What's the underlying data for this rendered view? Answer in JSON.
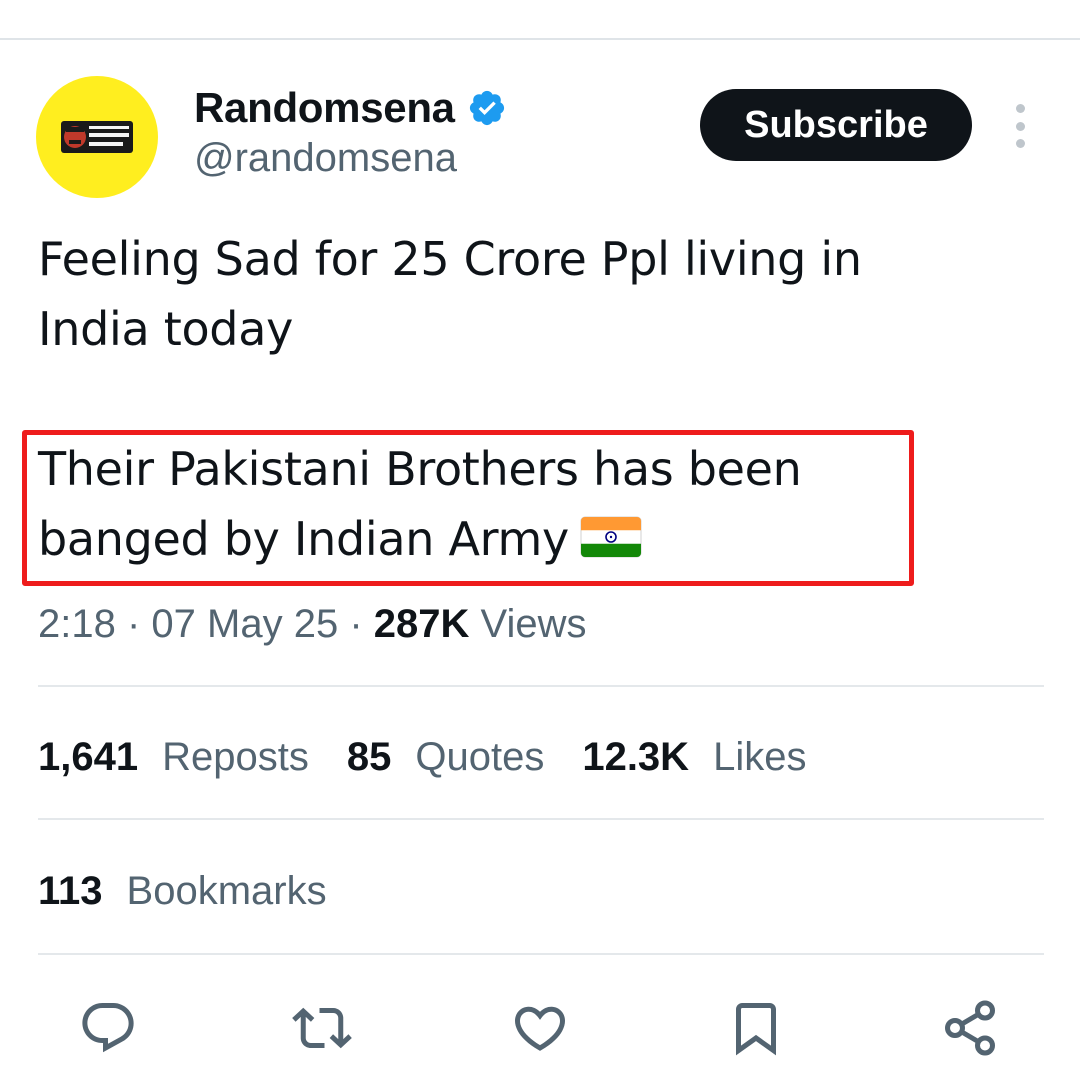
{
  "author": {
    "display_name": "Randomsena",
    "handle": "@randomsena",
    "verified": true,
    "avatar_logo_text": "THE RANDOM INDIAN"
  },
  "header": {
    "subscribe_label": "Subscribe",
    "more_icon": "more-vertical-icon"
  },
  "tweet": {
    "lines": [
      "Feeling Sad for 25 Crore Ppl living in",
      "India today",
      "Their Pakistani Brothers has been",
      "banged by Indian Army"
    ],
    "emoji": "india-flag-icon",
    "highlight_color": "#ee1c1c"
  },
  "meta": {
    "time": "2:18",
    "date": "07 May 25",
    "views_count": "287K",
    "views_label": "Views"
  },
  "stats": {
    "reposts_count": "1,641",
    "reposts_label": "Reposts",
    "quotes_count": "85",
    "quotes_label": "Quotes",
    "likes_count": "12.3K",
    "likes_label": "Likes",
    "bookmarks_count": "113",
    "bookmarks_label": "Bookmarks"
  },
  "actions": [
    "reply-icon",
    "repost-icon",
    "like-icon",
    "bookmark-icon",
    "share-icon"
  ],
  "colors": {
    "text_primary": "#0f1419",
    "text_secondary": "#536471",
    "verified_blue": "#1d9bf0",
    "avatar_yellow": "#ffee1f",
    "subscribe_bg": "#0f1419"
  }
}
